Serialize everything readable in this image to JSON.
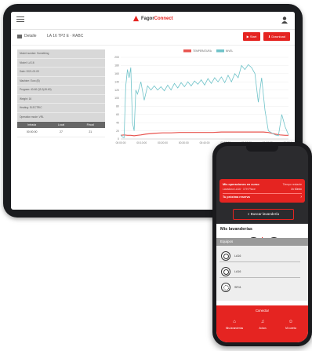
{
  "tablet": {
    "brand_prefix": "Fagor",
    "brand_suffix": "Connect",
    "brand_sub": "··· ···",
    "toolbar": {
      "detail_label": "Detalle",
      "device_label": "LA 16 TP2 E  ·  RABC",
      "start_label": "▶ Start",
      "download_label": "⬇ Download"
    },
    "info_rows": [
      "Model number: Something",
      "Model: LA 16",
      "Date: 2021-02-09",
      "Machine: Euro (B)",
      "Program: 40-60-Q3-2(45-60)",
      "Weight: 16",
      "Heating: ELECTRIC",
      "Operation mode: VRL"
    ],
    "table": {
      "headers": [
        "Intrada",
        "Local",
        "Fincal"
      ],
      "rows": [
        [
          "00:00:00",
          "27",
          "21"
        ]
      ]
    }
  },
  "chart_data": {
    "type": "line",
    "title": "",
    "series": [
      {
        "name": "TEMPERATURA",
        "color": "#e8544f",
        "x": [
          0,
          2,
          4,
          6,
          8,
          10,
          12,
          15,
          20,
          25,
          30,
          35,
          40,
          45,
          50,
          55,
          60,
          65,
          70,
          75,
          80,
          85,
          88,
          90,
          92,
          95,
          98,
          100
        ],
        "values": [
          9,
          10,
          9,
          9,
          8,
          9,
          10,
          12,
          14,
          15,
          15,
          16,
          16,
          16,
          16,
          16,
          17,
          17,
          17,
          17,
          17,
          17,
          16,
          14,
          12,
          10,
          9,
          9
        ]
      },
      {
        "name": "NIVEL",
        "color": "#6fc3c9",
        "x": [
          0,
          1,
          2,
          3,
          4,
          5,
          6,
          7,
          8,
          9,
          10,
          12,
          14,
          16,
          18,
          20,
          22,
          24,
          26,
          28,
          30,
          32,
          34,
          36,
          38,
          40,
          42,
          44,
          46,
          48,
          50,
          52,
          54,
          56,
          58,
          60,
          62,
          64,
          66,
          68,
          70,
          72,
          74,
          76,
          78,
          80,
          82,
          84,
          86,
          88,
          90,
          92,
          94,
          96,
          98,
          100
        ],
        "values": [
          10,
          5,
          3,
          130,
          170,
          150,
          175,
          40,
          20,
          120,
          110,
          140,
          95,
          130,
          120,
          130,
          120,
          128,
          118,
          132,
          120,
          136,
          125,
          138,
          128,
          140,
          130,
          142,
          134,
          145,
          132,
          148,
          136,
          150,
          140,
          152,
          138,
          156,
          140,
          160,
          150,
          180,
          170,
          182,
          175,
          160,
          90,
          150,
          70,
          20,
          15,
          10,
          8,
          60,
          30,
          10
        ]
      }
    ],
    "x_ticks": [
      "00:00:00",
      "00:10:00",
      "00:20:00",
      "00:30:00",
      "00:40:00",
      "00:50:00",
      "01:00:00",
      "01:10:00",
      "01:20:00"
    ],
    "y_ticks": [
      "0",
      "20",
      "40",
      "60",
      "80",
      "100",
      "120",
      "140",
      "160",
      "180",
      "200"
    ],
    "ylim": [
      0,
      200
    ],
    "xlim": [
      0,
      100
    ],
    "grid": true,
    "legend_position": "top-center"
  },
  "phone": {
    "ops_title": "Mis operaciones en curso",
    "ops_machine": "Lavadora LA16 · 1TH Place",
    "ops_time_label": "Tiempo restante",
    "ops_time_value": "1h 00min",
    "next_booking": "Tu próxima reserva",
    "search_label": "Buscar lavandería",
    "my_laundries": "Mis lavanderías",
    "washer_label": "Lavado",
    "dryer_label": "Secado",
    "equip_header": "Equipos",
    "equipment": [
      "LA16",
      "LA16",
      "SR11"
    ],
    "connect_label": "Conectar",
    "nav": [
      "Mis lavanderías",
      "Avisos",
      "Mi cuenta"
    ],
    "accent": "#e52421"
  }
}
